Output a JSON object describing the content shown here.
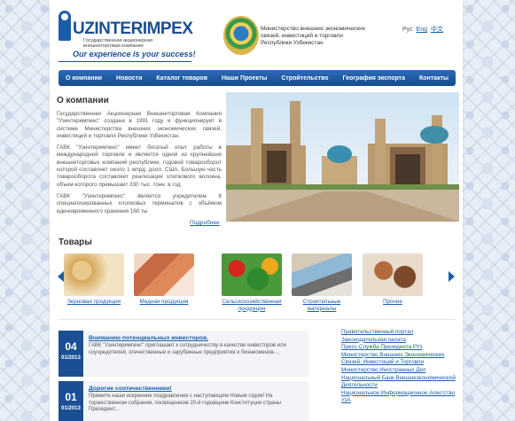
{
  "header": {
    "logo_title": "UZINTERIMPEX",
    "logo_subtitle": "Государственная акционерная внешнеторговая компания",
    "slogan": "Our experience is your success!",
    "ministry": "Министерство внешних экономических связей, инвестиций и торговли Республики Узбекистан",
    "languages": [
      {
        "label": "Рус",
        "current": true
      },
      {
        "label": "Eng",
        "current": false
      },
      {
        "label": "中文",
        "current": false
      }
    ]
  },
  "nav": {
    "items": [
      "О компании",
      "Новости",
      "Каталог товаров",
      "Наши Проекты",
      "Стройтельство",
      "География экспорта",
      "Контакты"
    ]
  },
  "about": {
    "title": "О компании",
    "paragraphs": [
      "Государственная Акционерная Внешнеторговая Компания \"Узинтеримпекс\" создана в 1991 году и функционирует в системе Министерства внешних экономических связей, инвестиций и торговли Республики Узбекистан.",
      "ГАВК \"Узинтеримпекс\" имеет богатый опыт работы в международной торговле и является одной из крупнейших внешнеторговых компаний республики, годовой товарооборот которой составляет около 1 млрд. долл. США. Большую часть товарооборота составляет реализация хлопкового волокна, объем которого превышает 330 тыс. тонн. в год.",
      "ГАВК \"Узинтеримпекс\" является учредителем 8 специализированных хлопковых терминалов с объёмом единовременного хранения 160 ты"
    ],
    "more_link": "Подробнее"
  },
  "products": {
    "title": "Товары",
    "items": [
      {
        "label": "Зерновая продукция",
        "icon": "grain-image"
      },
      {
        "label": "Медная продукция",
        "icon": "copper-image"
      },
      {
        "label": "Сельскохозяйственная продукция",
        "icon": "vegetables-image"
      },
      {
        "label": "Строительные материалы",
        "icon": "building-materials-image"
      },
      {
        "label": "Прочие",
        "icon": "other-goods-image"
      }
    ]
  },
  "news": [
    {
      "day": "04",
      "month": "01/2013",
      "title": "Вниманию потенциальных инвесторов.",
      "text": "ГАВК \"Узинтеримпекс\" приглашает к сотрудничеству в качестве инвесторов или соучредителей, отечественные и зарубежные предприятия и бизнесменов-..."
    },
    {
      "day": "01",
      "month": "01/2013",
      "title": "Дорогие соотечественники!",
      "text": "Примите наши искренние поздравления с наступающим Новым годом! На торжественном собрании, посвященном 20-й годовщине Конституции страны Президент..."
    }
  ],
  "links": [
    "Правительственный портал",
    "Законодательная палата",
    "Пресс-Служба Президента РУз",
    "Министерство Внешних Экономических Связей, Инвестиций и Торговли",
    "Министерство Иностранных Дел",
    "Национальный Банк Внешнеэкономической Деятельности",
    "Национальное Информационное Агентство УзА"
  ],
  "colors": {
    "brand": "#1a4f93",
    "nav": "#1f5ea6",
    "link": "#1a5ea8"
  }
}
